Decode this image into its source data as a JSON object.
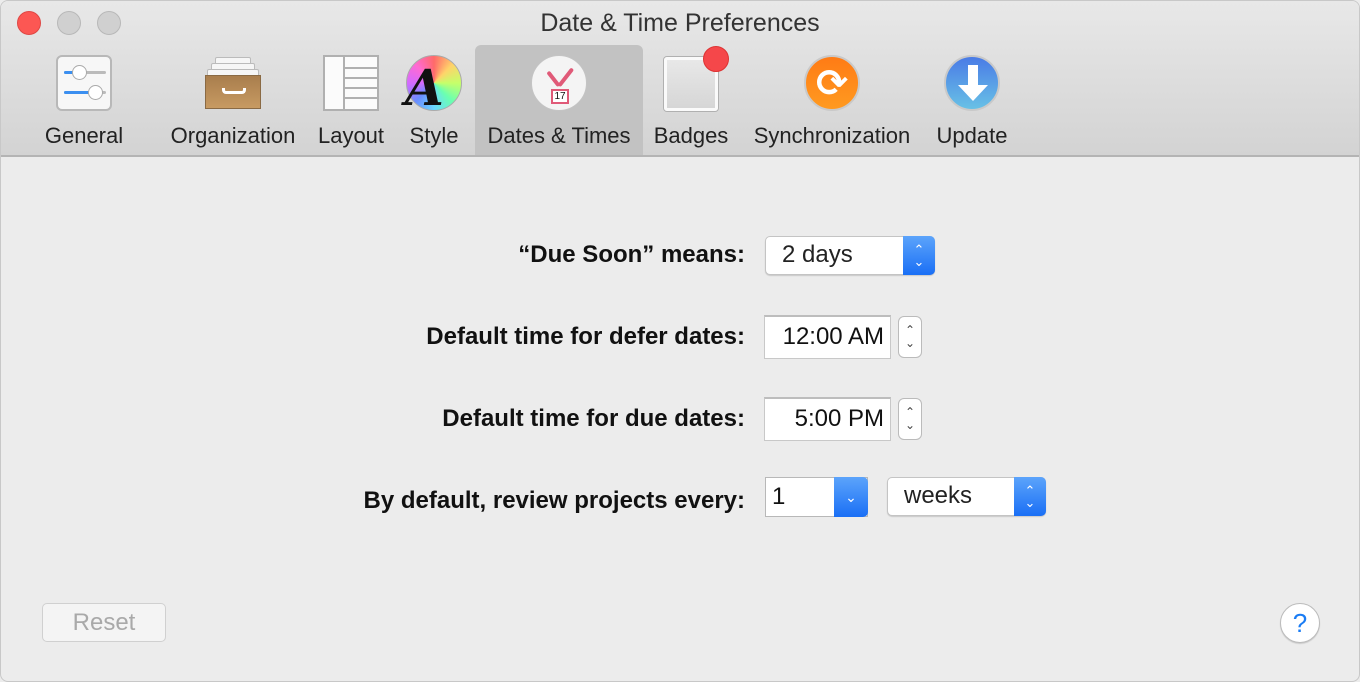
{
  "window": {
    "title": "Date & Time Preferences",
    "traffic_lights": [
      "close",
      "minimize",
      "zoom"
    ]
  },
  "toolbar": {
    "selected": "Dates & Times",
    "items": [
      {
        "label": "General",
        "icon": "sliders-icon"
      },
      {
        "label": "Organization",
        "icon": "file-drawer-icon"
      },
      {
        "label": "Layout",
        "icon": "layout-columns-icon"
      },
      {
        "label": "Style",
        "icon": "color-wheel-font-icon"
      },
      {
        "label": "Dates & Times",
        "icon": "clock-calendar-icon"
      },
      {
        "label": "Badges",
        "icon": "badge-icon"
      },
      {
        "label": "Synchronization",
        "icon": "sync-icon"
      },
      {
        "label": "Update",
        "icon": "download-arrow-icon"
      }
    ],
    "calendar_day": "17",
    "sync_glyph": "⟳"
  },
  "form": {
    "due_soon": {
      "label": "“Due Soon” means:",
      "value": "2 days"
    },
    "defer_time": {
      "label": "Default time for defer dates:",
      "value": "12:00 AM"
    },
    "due_time": {
      "label": "Default time for due dates:",
      "value": "5:00 PM"
    },
    "review": {
      "label": "By default, review projects every:",
      "count": "1",
      "unit": "weeks"
    }
  },
  "glyphs": {
    "up": "⌃",
    "down": "⌄",
    "chevron_down": "⌄",
    "help": "?"
  },
  "footer": {
    "reset_label": "Reset",
    "reset_enabled": false
  },
  "colors": {
    "accent": "#1a6ff5",
    "close": "#fc5753",
    "selected_tab": "#c2c2c2"
  }
}
